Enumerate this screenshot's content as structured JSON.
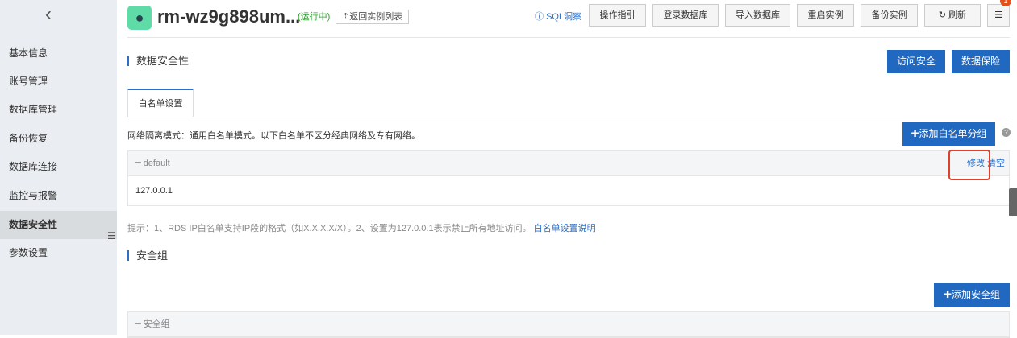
{
  "sidebar": {
    "items": [
      "基本信息",
      "账号管理",
      "数据库管理",
      "备份恢复",
      "数据库连接",
      "监控与报警",
      "数据安全性",
      "参数设置"
    ],
    "active": "数据安全性"
  },
  "header": {
    "title": "rm-wz9g898um...",
    "status": "(运行中)",
    "back_label": "返回实例列表",
    "sql_label": "SQL洞察",
    "buttons": [
      "操作指引",
      "登录数据库",
      "导入数据库",
      "重启实例",
      "备份实例",
      "刷新"
    ],
    "badge": "1"
  },
  "section1": {
    "title": "数据安全性",
    "btn_access": "访问安全",
    "btn_protect": "数据保险",
    "tab": "白名单设置",
    "desc": "网络隔离模式：通用白名单模式。以下白名单不区分经典网络及专有网络。",
    "add_btn": "添加白名单分组",
    "group": {
      "name": "default",
      "edit": "修改",
      "clear": "清空",
      "ips": "127.0.0.1"
    },
    "hint": "提示：1、RDS IP白名单支持IP段的格式（如X.X.X.X/X）。2、设置为127.0.0.1表示禁止所有地址访问。",
    "hint_link": "白名单设置说明"
  },
  "section2": {
    "title": "安全组",
    "add_btn": "添加安全组",
    "group_name": "安全组"
  }
}
